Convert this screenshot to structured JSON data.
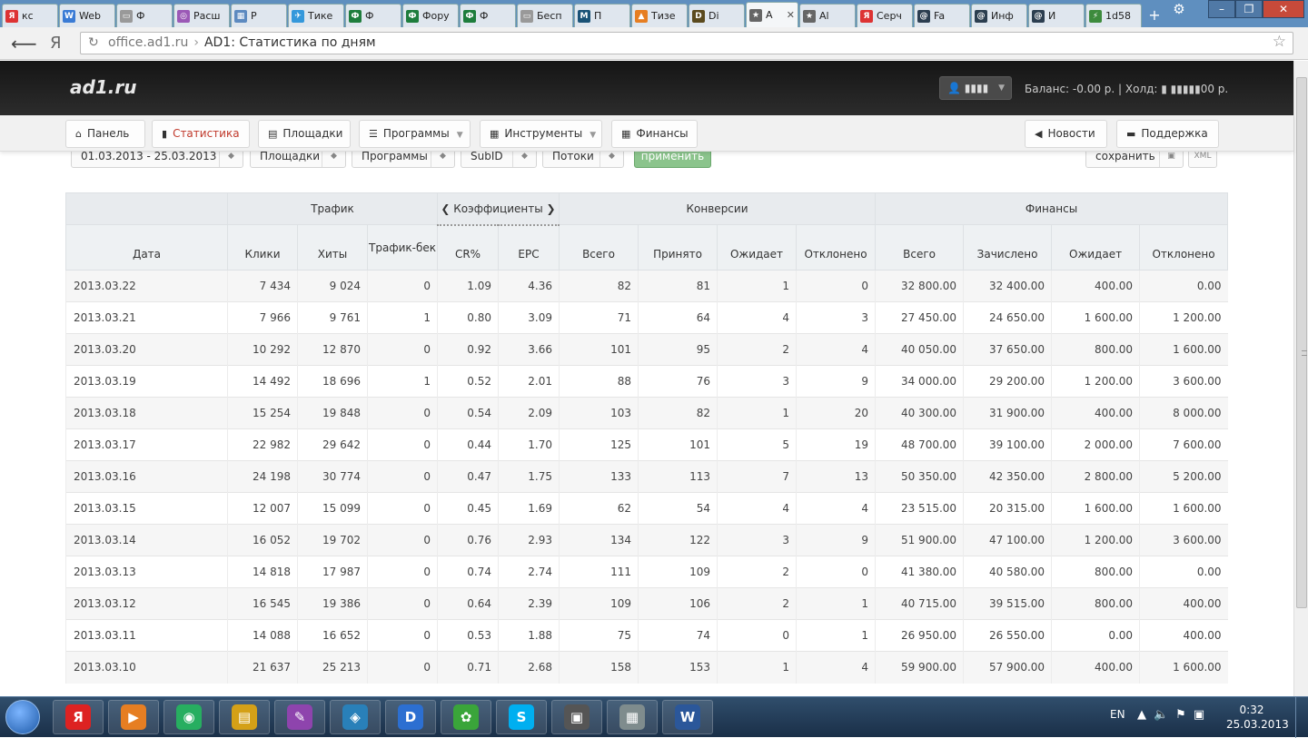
{
  "browser": {
    "tabs": [
      {
        "label": "кс",
        "icon": "Я",
        "color": "#d33"
      },
      {
        "label": "Web",
        "icon": "W",
        "color": "#3a7bd5"
      },
      {
        "label": "Ф",
        "icon": "▭",
        "color": "#999"
      },
      {
        "label": "Расш",
        "icon": "◎",
        "color": "#9b59b6"
      },
      {
        "label": "Р",
        "icon": "▦",
        "color": "#5d8ac0"
      },
      {
        "label": "Тике",
        "icon": "✈",
        "color": "#3498db"
      },
      {
        "label": "Ф",
        "icon": "Ф",
        "color": "#1e7d3c"
      },
      {
        "label": "Фору",
        "icon": "Ф",
        "color": "#1e7d3c"
      },
      {
        "label": "Ф",
        "icon": "Ф",
        "color": "#1e7d3c"
      },
      {
        "label": "Бесп",
        "icon": "▭",
        "color": "#999"
      },
      {
        "label": "П",
        "icon": "M",
        "color": "#1a5276"
      },
      {
        "label": "Тизе",
        "icon": "▲",
        "color": "#e67e22"
      },
      {
        "label": "Di",
        "icon": "D",
        "color": "#5b4a1e"
      },
      {
        "label": "A",
        "icon": "★",
        "color": "#666",
        "active": true
      },
      {
        "label": "Al",
        "icon": "★",
        "color": "#666"
      },
      {
        "label": "Серч",
        "icon": "Я",
        "color": "#d33"
      },
      {
        "label": "Fa",
        "icon": "@",
        "color": "#2c3e50"
      },
      {
        "label": "Инф",
        "icon": "@",
        "color": "#2c3e50"
      },
      {
        "label": "И",
        "icon": "@",
        "color": "#2c3e50"
      },
      {
        "label": "1d58",
        "icon": "⚡",
        "color": "#3d8b3d"
      }
    ],
    "url_domain": "office.ad1.ru",
    "url_separator": "›",
    "url_title": "AD1: Статистика по дням",
    "window_buttons": [
      "–",
      "❐",
      "✕"
    ]
  },
  "site": {
    "logo": "ad1.ru",
    "user": "▮▮▮▮",
    "balance": "Баланс: -0.00 р.  |  Холд: ▮ ▮▮▮▮▮00 р."
  },
  "nav": {
    "panel": "Панель",
    "stats": "Статистика",
    "sites": "Площадки",
    "programs": "Программы",
    "tools": "Инструменты",
    "finance": "Финансы",
    "news": "Новости",
    "support": "Поддержка"
  },
  "filters": {
    "daterange": "01.03.2013 - 25.03.2013",
    "sites": "Площадки",
    "programs": "Программы",
    "subid": "SubID",
    "streams": "Потоки",
    "apply": "применить",
    "save": "сохранить",
    "xml": "XML"
  },
  "table": {
    "groups": {
      "traffic": "Трафик",
      "coef": "Коэффициенты",
      "conversions": "Конверсии",
      "finance": "Финансы"
    },
    "columns": [
      "Дата",
      "Клики",
      "Хиты",
      "Трафик-бек",
      "CR%",
      "EPC",
      "Всего",
      "Принято",
      "Ожидает",
      "Отклонено",
      "Всего",
      "Зачислено",
      "Ожидает",
      "Отклонено"
    ],
    "rows": [
      [
        "2013.03.22",
        "7 434",
        "9 024",
        "0",
        "1.09",
        "4.36",
        "82",
        "81",
        "1",
        "0",
        "32 800.00",
        "32 400.00",
        "400.00",
        "0.00"
      ],
      [
        "2013.03.21",
        "7 966",
        "9 761",
        "1",
        "0.80",
        "3.09",
        "71",
        "64",
        "4",
        "3",
        "27 450.00",
        "24 650.00",
        "1 600.00",
        "1 200.00"
      ],
      [
        "2013.03.20",
        "10 292",
        "12 870",
        "0",
        "0.92",
        "3.66",
        "101",
        "95",
        "2",
        "4",
        "40 050.00",
        "37 650.00",
        "800.00",
        "1 600.00"
      ],
      [
        "2013.03.19",
        "14 492",
        "18 696",
        "1",
        "0.52",
        "2.01",
        "88",
        "76",
        "3",
        "9",
        "34 000.00",
        "29 200.00",
        "1 200.00",
        "3 600.00"
      ],
      [
        "2013.03.18",
        "15 254",
        "19 848",
        "0",
        "0.54",
        "2.09",
        "103",
        "82",
        "1",
        "20",
        "40 300.00",
        "31 900.00",
        "400.00",
        "8 000.00"
      ],
      [
        "2013.03.17",
        "22 982",
        "29 642",
        "0",
        "0.44",
        "1.70",
        "125",
        "101",
        "5",
        "19",
        "48 700.00",
        "39 100.00",
        "2 000.00",
        "7 600.00"
      ],
      [
        "2013.03.16",
        "24 198",
        "30 774",
        "0",
        "0.47",
        "1.75",
        "133",
        "113",
        "7",
        "13",
        "50 350.00",
        "42 350.00",
        "2 800.00",
        "5 200.00"
      ],
      [
        "2013.03.15",
        "12 007",
        "15 099",
        "0",
        "0.45",
        "1.69",
        "62",
        "54",
        "4",
        "4",
        "23 515.00",
        "20 315.00",
        "1 600.00",
        "1 600.00"
      ],
      [
        "2013.03.14",
        "16 052",
        "19 702",
        "0",
        "0.76",
        "2.93",
        "134",
        "122",
        "3",
        "9",
        "51 900.00",
        "47 100.00",
        "1 200.00",
        "3 600.00"
      ],
      [
        "2013.03.13",
        "14 818",
        "17 987",
        "0",
        "0.74",
        "2.74",
        "111",
        "109",
        "2",
        "0",
        "41 380.00",
        "40 580.00",
        "800.00",
        "0.00"
      ],
      [
        "2013.03.12",
        "16 545",
        "19 386",
        "0",
        "0.64",
        "2.39",
        "109",
        "106",
        "2",
        "1",
        "40 715.00",
        "39 515.00",
        "800.00",
        "400.00"
      ],
      [
        "2013.03.11",
        "14 088",
        "16 652",
        "0",
        "0.53",
        "1.88",
        "75",
        "74",
        "0",
        "1",
        "26 950.00",
        "26 550.00",
        "0.00",
        "400.00"
      ],
      [
        "2013.03.10",
        "21 637",
        "25 213",
        "0",
        "0.71",
        "2.68",
        "158",
        "153",
        "1",
        "4",
        "59 900.00",
        "57 900.00",
        "400.00",
        "1 600.00"
      ]
    ]
  },
  "taskbar": {
    "apps": [
      {
        "glyph": "Я",
        "color": "#d22"
      },
      {
        "glyph": "▶",
        "color": "#e67e22"
      },
      {
        "glyph": "◉",
        "color": "#27ae60"
      },
      {
        "glyph": "▤",
        "color": "#d4a017"
      },
      {
        "glyph": "✎",
        "color": "#8e44ad"
      },
      {
        "glyph": "◈",
        "color": "#2980b9"
      },
      {
        "glyph": "D",
        "color": "#2c6fd1"
      },
      {
        "glyph": "✿",
        "color": "#3aa53a"
      },
      {
        "glyph": "S",
        "color": "#00aff0"
      },
      {
        "glyph": "▣",
        "color": "#555"
      },
      {
        "glyph": "▦",
        "color": "#7f8c8d"
      },
      {
        "glyph": "W",
        "color": "#2b579a"
      }
    ],
    "lang": "EN",
    "tray_icons": "▲🔈⚑▣",
    "time": "0:32",
    "date": "25.03.2013"
  }
}
